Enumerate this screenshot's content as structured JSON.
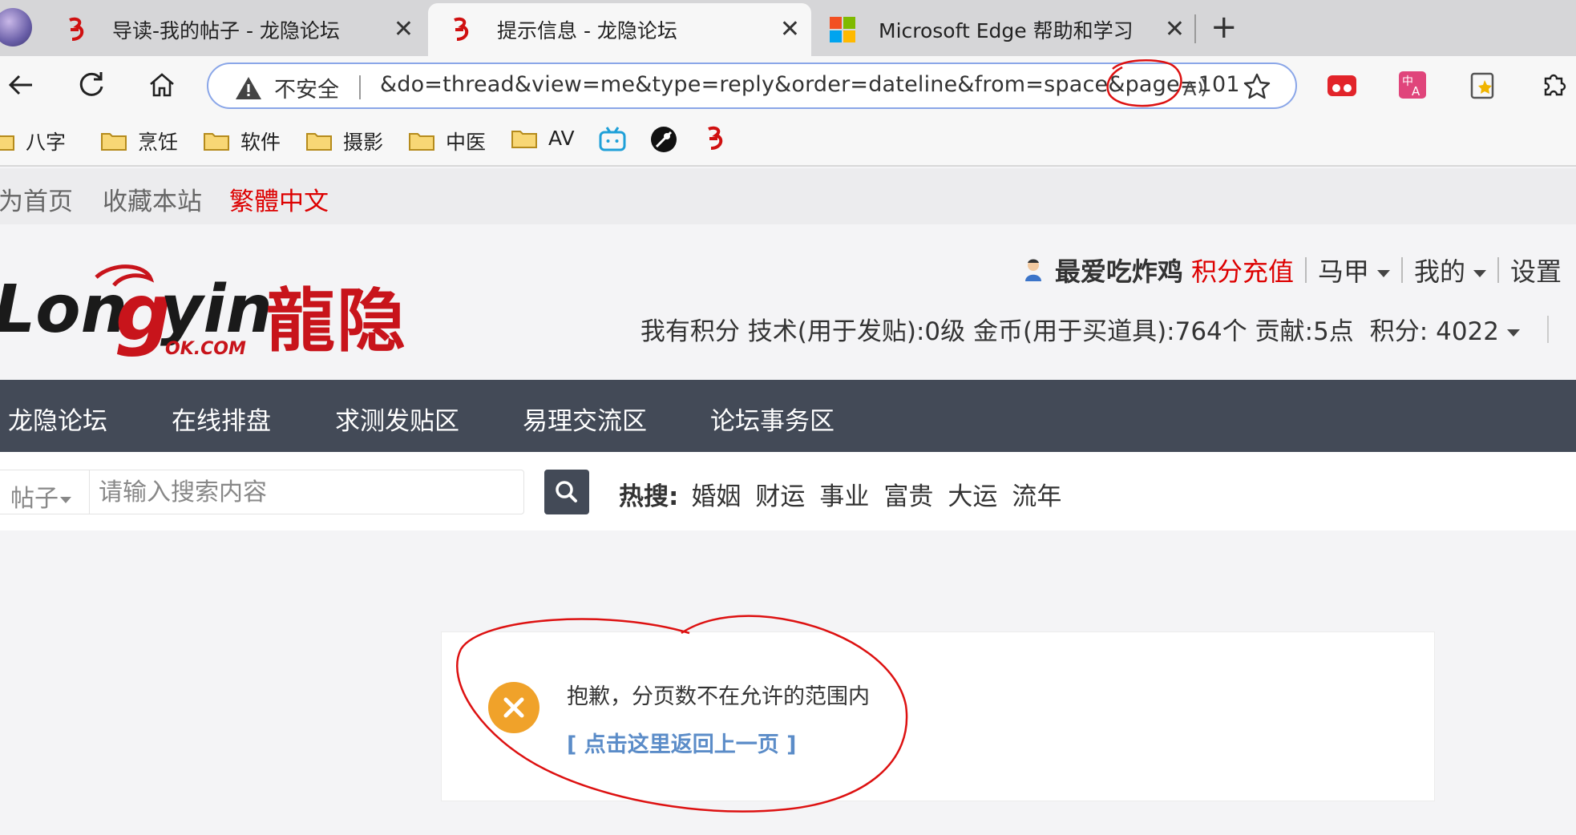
{
  "browser": {
    "tabs": [
      {
        "title": "导读-我的帖子 - 龙隐论坛",
        "active": false
      },
      {
        "title": "提示信息 - 龙隐论坛",
        "active": true
      },
      {
        "title": "Microsoft Edge 帮助和学习",
        "active": false
      }
    ],
    "close_glyph": "✕",
    "newtab_glyph": "+",
    "address": {
      "security": "不安全",
      "url": "&do=thread&view=me&type=reply&order=dateline&from=space&page=101"
    },
    "bookmarks": [
      "八字",
      "烹饪",
      "软件",
      "摄影",
      "中医",
      "AV"
    ]
  },
  "site": {
    "topnav": {
      "home": "为首页",
      "favorite": "收藏本站",
      "traditional": "繁體中文"
    },
    "user": {
      "name": "最爱吃炸鸡",
      "charge": "积分充值",
      "menu": [
        "马甲",
        "我的",
        "设置"
      ]
    },
    "credits": {
      "text": "我有积分 技术(用于发贴):0级 金币(用于买道具):764个 贡献:5点",
      "score": "积分: 4022"
    },
    "mainnav": [
      "龙隐论坛",
      "在线排盘",
      "求测发贴区",
      "易理交流区",
      "论坛事务区"
    ],
    "search": {
      "type": "帖子",
      "placeholder": "请输入搜索内容",
      "hot_label": "热搜:",
      "hot": [
        "婚姻",
        "财运",
        "事业",
        "富贵",
        "大运",
        "流年"
      ]
    },
    "message": {
      "text": "抱歉，分页数不在允许的范围内",
      "back": "[ 点击这里返回上一页 ]"
    }
  },
  "colors": {
    "accent_red": "#dd0000",
    "nav_dark": "#434a57",
    "link_blue": "#5b8cc8",
    "error_orange": "#f0a22a"
  }
}
